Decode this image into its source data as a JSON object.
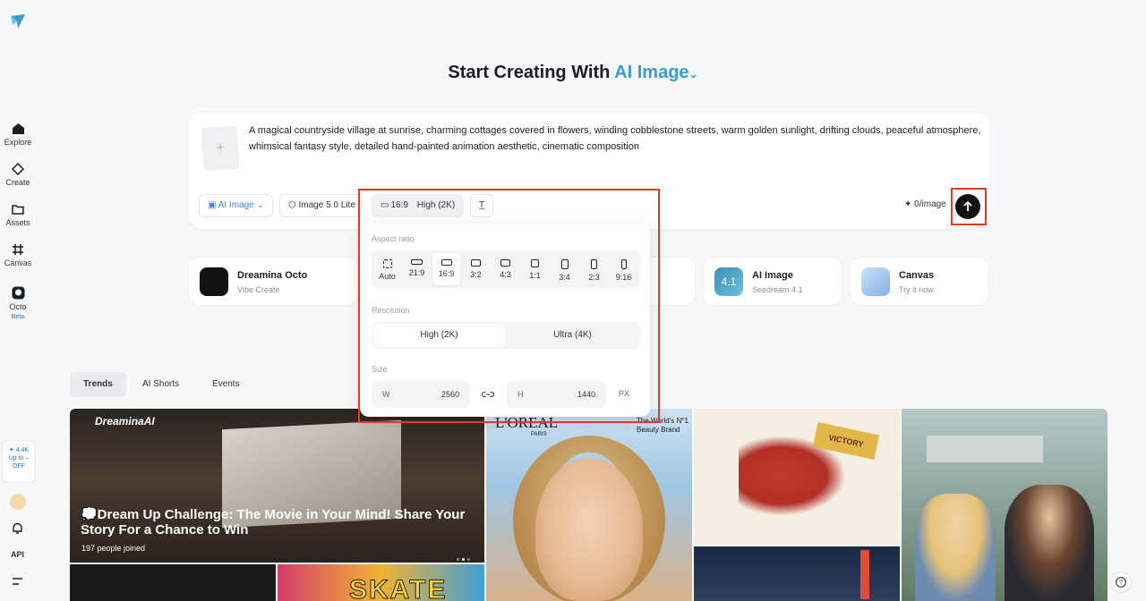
{
  "sidebar": {
    "items": [
      {
        "label": "Explore",
        "icon": "home-icon"
      },
      {
        "label": "Create",
        "icon": "diamond-icon"
      },
      {
        "label": "Assets",
        "icon": "folder-icon"
      },
      {
        "label": "Canvas",
        "icon": "canvas-icon"
      },
      {
        "label": "Octo",
        "icon": "octo-icon",
        "badge": "Beta"
      }
    ],
    "promo": {
      "count": "✦ 4.4K",
      "line1": "Up to –",
      "line2": "OFF"
    },
    "api_label": "API"
  },
  "heading": {
    "prefix": "Start Creating With",
    "accent": "AI Image"
  },
  "prompt": {
    "text": "A magical countryside village at sunrise, charming cottages covered in flowers, winding cobblestone streets, warm golden sunlight, drifting clouds, peaceful atmosphere, whimsical fantasy style, detailed hand-painted animation aesthetic, cinematic composition",
    "add_symbol": "+",
    "mode_chip": "AI Image",
    "model_chip": "Image 5.0 Lite",
    "ratio_chip": "16:9",
    "resolution_chip": "High (2K)",
    "credits": "0/image"
  },
  "quick_cards": [
    {
      "title": "Dreamina Octo",
      "subtitle": "Vibe Create"
    },
    {
      "title": "AI Image",
      "subtitle": "Seedream 4.1",
      "icon_text": "4.1"
    },
    {
      "title": "Canvas",
      "subtitle": "Try it now"
    }
  ],
  "tabs": [
    "Trends",
    "AI Shorts",
    "Events"
  ],
  "gallery": {
    "featured": {
      "brand": "DreaminaAI",
      "title": "💭Dream Up Challenge: The Movie in Your Mind! Share Your Story For a Chance to Win",
      "joined": "197  people joined"
    },
    "ad": {
      "brand": "L'OREAL",
      "sub": "PARIS",
      "slogan1": "The World's N°1",
      "slogan2": "Beauty Brand"
    },
    "horse_flag": "VICTORY",
    "skate": "SKATE"
  },
  "popover": {
    "aspect_label": "Aspect ratio",
    "ratios": [
      "Auto",
      "21:9",
      "16:9",
      "3:2",
      "4:3",
      "1:1",
      "3:4",
      "2:3",
      "9:16"
    ],
    "selected_ratio": "16:9",
    "resolution_label": "Resolution",
    "resolutions": [
      "High (2K)",
      "Ultra (4K)"
    ],
    "selected_resolution": "High (2K)",
    "size_label": "Size",
    "width_key": "W",
    "width_value": "2560",
    "height_key": "H",
    "height_value": "1440",
    "unit": "PX"
  },
  "colors": {
    "accent": "#3a9bd6",
    "highlight": "#e03a2a",
    "send": "#111111"
  }
}
